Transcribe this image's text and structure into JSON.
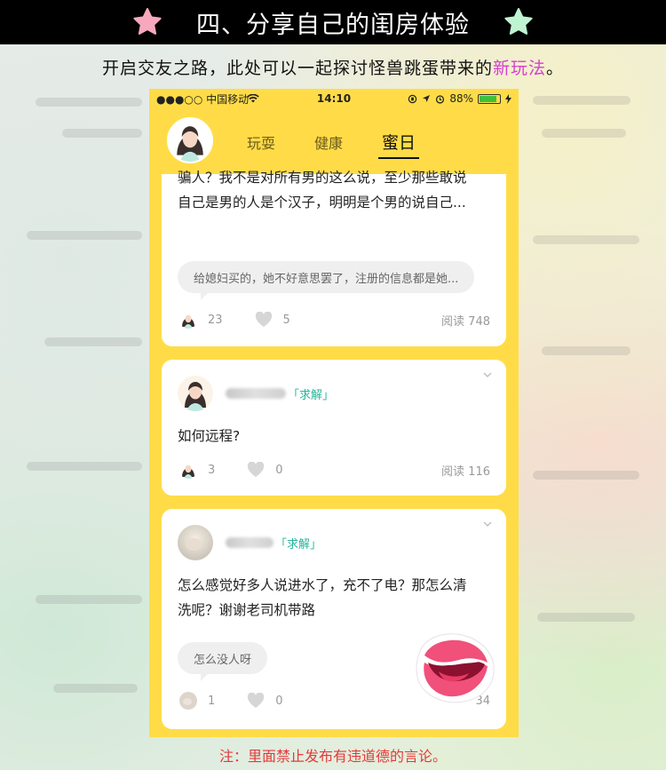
{
  "title": "四、分享自己的闺房体验",
  "subtitle_main": "开启交友之路，此处可以一起探讨怪兽跳蛋带来的",
  "subtitle_highlight": "新玩法",
  "subtitle_end": "。",
  "status_bar": {
    "carrier": "●●●○○ 中国移动",
    "time": "14:10",
    "battery": "88%",
    "battery_level": 0.88
  },
  "tabs": [
    {
      "label": "玩耍",
      "active": false
    },
    {
      "label": "健康",
      "active": false
    },
    {
      "label": "蜜日",
      "active": true
    }
  ],
  "posts": [
    {
      "text_line1": "骗人？我不是对所有男的这么说，至少那些敢说",
      "text_line2": "自己是男的人是个汉子，明明是个男的说自己...",
      "reply": "给媳妇买的，她不好意思罢了，注册的信息都是她...",
      "comments": "23",
      "likes": "5",
      "views": "阅读 748"
    },
    {
      "tag": "「求解」",
      "text": "如何远程?",
      "comments": "3",
      "likes": "0",
      "views": "阅读 116"
    },
    {
      "tag": "「求解」",
      "text_line1": "怎么感觉好多人说进水了，充不了电？那怎么清",
      "text_line2": "洗呢？谢谢老司机带路",
      "reply": "怎么没人呀",
      "comments": "1",
      "likes": "0",
      "views": "34"
    }
  ],
  "note": "注：里面禁止发布有违道德的言论。",
  "colors": {
    "accent_yellow": "#ffdc47",
    "tag_green": "#26b49b",
    "note_red": "#e33a3a",
    "highlight_magenta": "#d63fd0"
  }
}
